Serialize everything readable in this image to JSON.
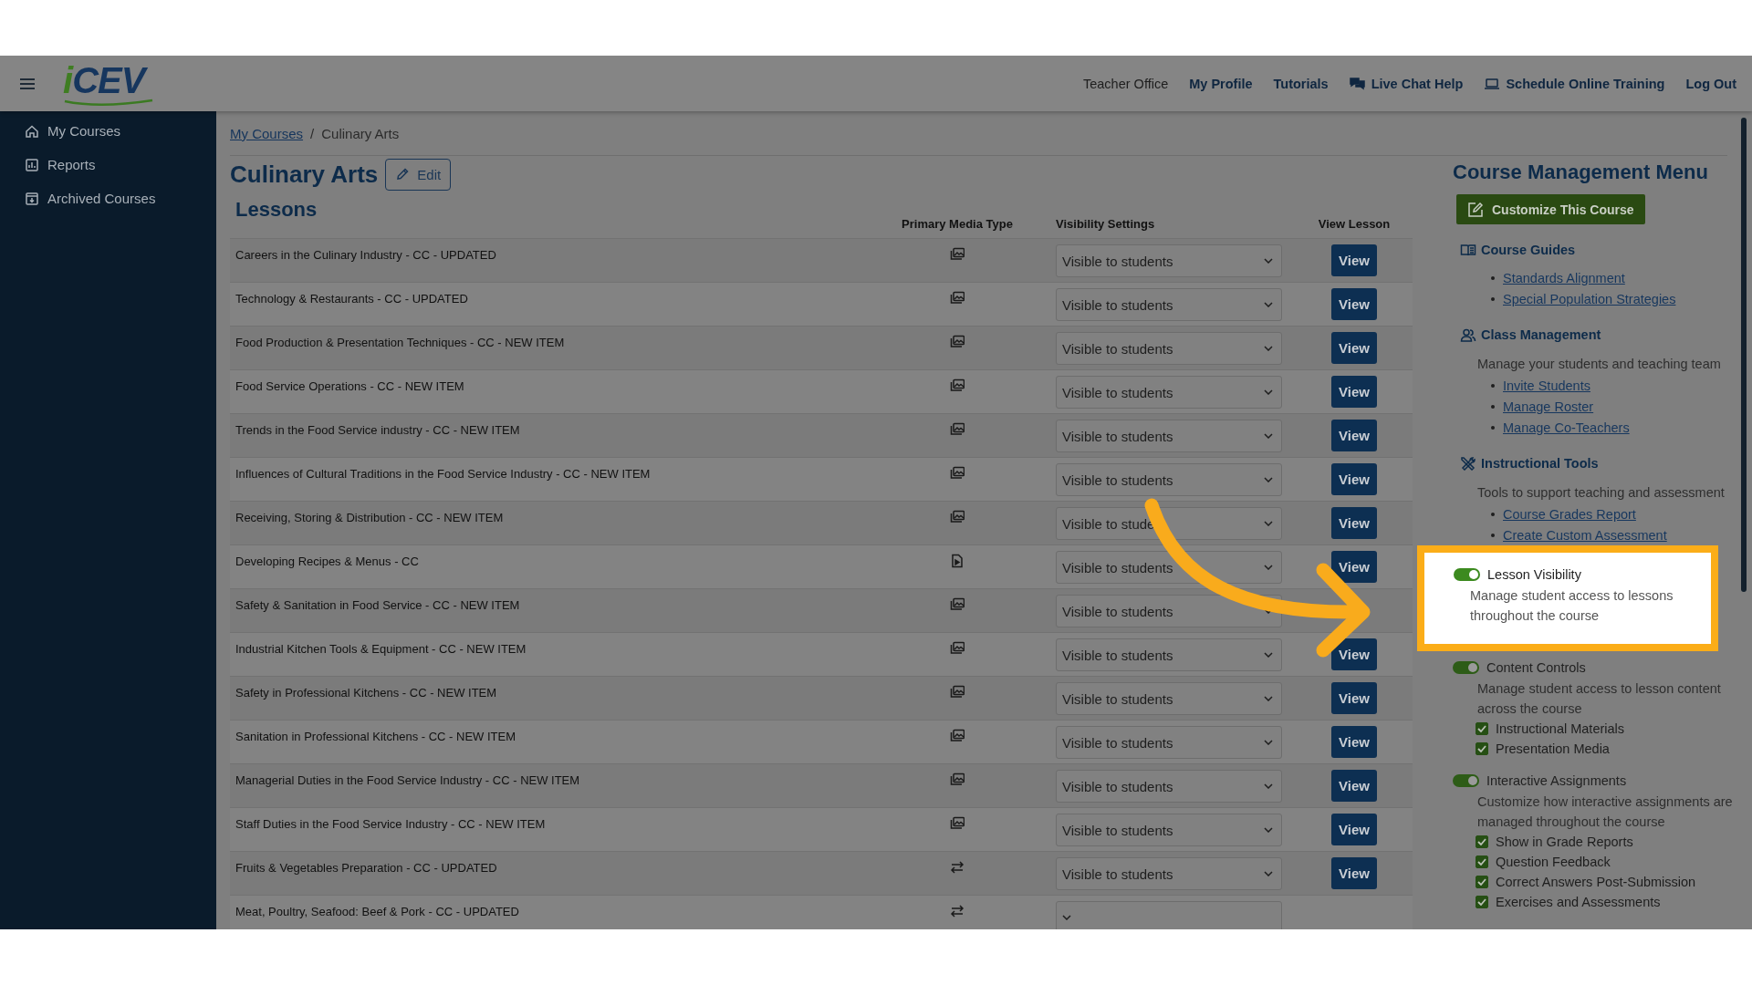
{
  "header": {
    "logo": "iCEV",
    "nav": [
      {
        "label": "Teacher Office",
        "kind": "plain"
      },
      {
        "label": "My Profile",
        "kind": "link"
      },
      {
        "label": "Tutorials",
        "kind": "link"
      },
      {
        "label": "Live Chat Help",
        "kind": "chat"
      },
      {
        "label": "Schedule Online Training",
        "kind": "laptop"
      },
      {
        "label": "Log Out",
        "kind": "link"
      }
    ]
  },
  "sidebar": {
    "items": [
      {
        "label": "My Courses",
        "kind": "home"
      },
      {
        "label": "Reports",
        "kind": "chart"
      },
      {
        "label": "Archived Courses",
        "kind": "archive"
      }
    ]
  },
  "breadcrumb": [
    {
      "label": "My Courses",
      "kind": "link"
    },
    {
      "label": "/",
      "kind": "separator"
    },
    {
      "label": "Culinary Arts",
      "kind": "current"
    }
  ],
  "page_title": "Culinary Arts",
  "edit_button": "Edit",
  "lessons": {
    "heading": "Lessons",
    "columns": [
      "Primary Media Type",
      "Visibility Settings",
      "View Lesson"
    ],
    "rows": [
      {
        "title": "Careers in the Culinary Industry - CC - UPDATED",
        "kind": "gallery",
        "visibility": "Visible to students",
        "button": "View"
      },
      {
        "title": "Technology & Restaurants - CC - UPDATED",
        "kind": "gallery",
        "visibility": "Visible to students",
        "button": "View"
      },
      {
        "title": "Food Production & Presentation Techniques - CC - NEW ITEM",
        "kind": "gallery",
        "visibility": "Visible to students",
        "button": "View"
      },
      {
        "title": "Food Service Operations - CC - NEW ITEM",
        "kind": "gallery",
        "visibility": "Visible to students",
        "button": "View"
      },
      {
        "title": "Trends in the Food Service industry - CC - NEW ITEM",
        "kind": "gallery",
        "visibility": "Visible to students",
        "button": "View"
      },
      {
        "title": "Influences of Cultural Traditions in the Food Service Industry - CC - NEW ITEM",
        "kind": "gallery",
        "visibility": "Visible to students",
        "button": "View"
      },
      {
        "title": "Receiving, Storing & Distribution - CC - NEW ITEM",
        "kind": "gallery",
        "visibility": "Visible to stude",
        "button": "View"
      },
      {
        "title": "Developing Recipes & Menus - CC",
        "kind": "document",
        "visibility": "Visible to students",
        "button": "View"
      },
      {
        "title": "Safety & Sanitation in Food Service - CC - NEW ITEM",
        "kind": "gallery",
        "visibility": "Visible to students"
      },
      {
        "title": "Industrial Kitchen Tools & Equipment - CC - NEW ITEM",
        "kind": "gallery",
        "visibility": "Visible to students",
        "button": "View"
      },
      {
        "title": "Safety in Professional Kitchens - CC - NEW ITEM",
        "kind": "gallery",
        "visibility": "Visible to students",
        "button": "View"
      },
      {
        "title": "Sanitation in Professional Kitchens - CC - NEW ITEM",
        "kind": "gallery",
        "visibility": "Visible to students",
        "button": "View"
      },
      {
        "title": "Managerial Duties in the Food Service Industry - CC - NEW ITEM",
        "kind": "gallery",
        "visibility": "Visible to students",
        "button": "View"
      },
      {
        "title": "Staff Duties in the Food Service Industry - CC - NEW ITEM",
        "kind": "gallery",
        "visibility": "Visible to students",
        "button": "View"
      },
      {
        "title": "Fruits & Vegetables Preparation - CC - UPDATED",
        "kind": "exchange",
        "visibility": "Visible to students",
        "button": "View"
      },
      {
        "title": "Meat, Poultry, Seafood: Beef & Pork - CC - UPDATED",
        "kind": "exchange"
      }
    ]
  },
  "course_menu": {
    "title": "Course Management Menu",
    "customize_button": "Customize This Course",
    "sections": [
      {
        "kind": "book",
        "heading": "Course Guides",
        "links": [
          "Standards Alignment",
          "Special Population Strategies"
        ]
      },
      {
        "kind": "people",
        "heading": "Class Management",
        "description": "Manage your students and teaching team",
        "links": [
          "Invite Students",
          "Manage Roster",
          "Manage Co-Teachers"
        ]
      },
      {
        "kind": "tools",
        "heading": "Instructional Tools",
        "description": "Tools to support teaching and assessment",
        "links": [
          "Course Grades Report",
          "Create Custom Assessment"
        ]
      }
    ],
    "settings": [
      {
        "label": "Lesson Visibility",
        "on": true,
        "highlighted": true,
        "description": "Manage student access to lessons throughout the course"
      },
      {
        "label": "Content Controls",
        "on": true,
        "highlighted": false,
        "description": "Manage student access to lesson content across the course",
        "options": [
          {
            "label": "Instructional Materials",
            "checked": true
          },
          {
            "label": "Presentation Media",
            "checked": true
          }
        ]
      },
      {
        "label": "Interactive Assignments",
        "on": true,
        "highlighted": false,
        "description": "Customize how interactive assignments are managed throughout the course",
        "options": [
          {
            "label": "Show in Grade Reports",
            "checked": true
          },
          {
            "label": "Question Feedback",
            "checked": true
          },
          {
            "label": "Correct Answers Post-Submission",
            "checked": true
          },
          {
            "label": "Exercises and Assessments",
            "checked": true
          }
        ]
      }
    ]
  }
}
